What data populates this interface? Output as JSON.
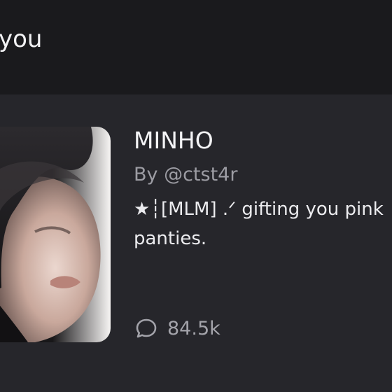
{
  "section": {
    "title": "you"
  },
  "character_card": {
    "name": "MINHO",
    "creator": "By @ctst4r",
    "description": "★┆[MLM] .ᐟ gifting you pink panties.",
    "chat_count": "84.5k",
    "stats_icon": "chat-bubble-icon",
    "thumbnail": "character-avatar-photo"
  },
  "colors": {
    "background": "#1a1a1d",
    "card": "#26262b",
    "text_primary": "#f4f4f6",
    "text_secondary": "#9c9ca3"
  }
}
